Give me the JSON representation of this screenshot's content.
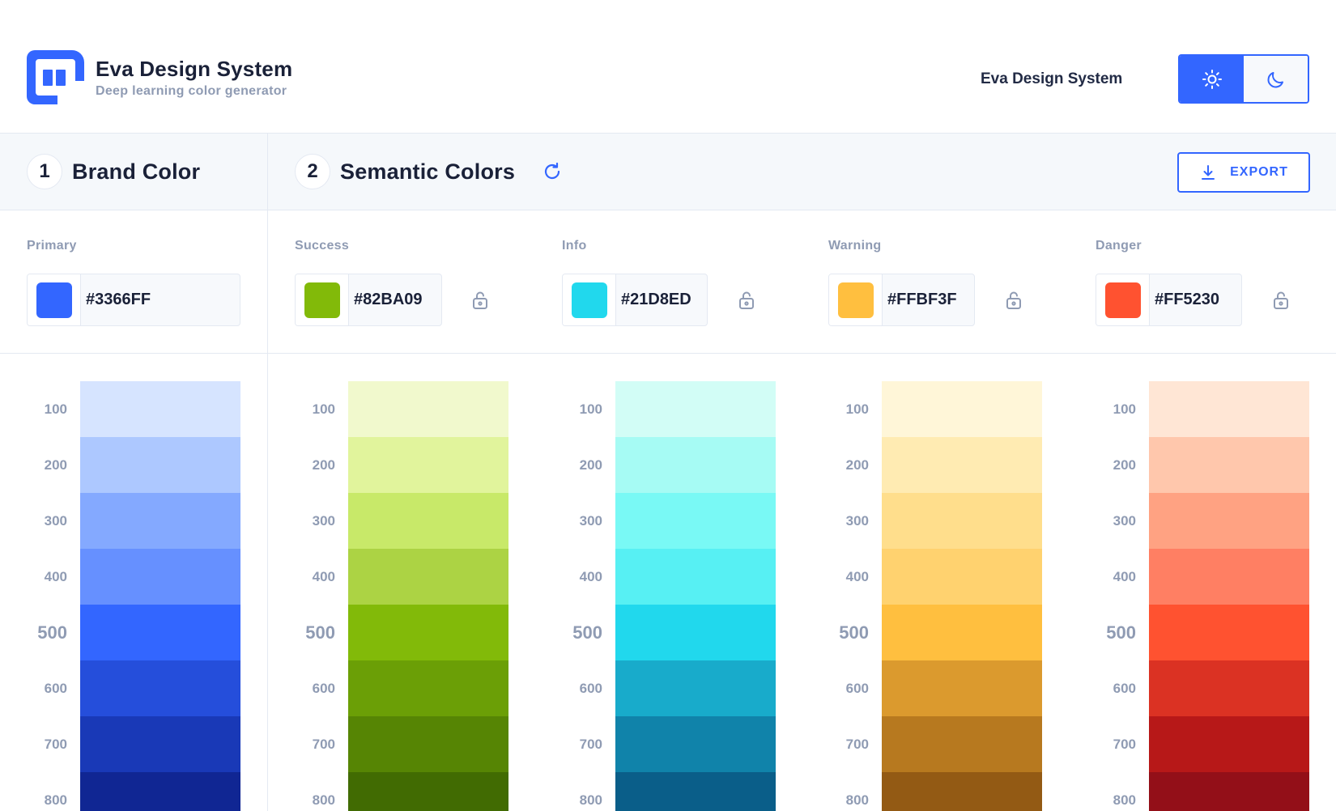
{
  "header": {
    "title": "Eva Design System",
    "subtitle": "Deep learning color generator",
    "link": "Eva Design System",
    "brand_color": "#3366ff"
  },
  "theme_toggle": {
    "options": [
      {
        "name": "light",
        "icon": "sun-icon",
        "active": true
      },
      {
        "name": "dark",
        "icon": "moon-icon",
        "active": false
      }
    ]
  },
  "sections": [
    {
      "number": "1",
      "title": "Brand Color"
    },
    {
      "number": "2",
      "title": "Semantic Colors",
      "icon": "refresh-icon"
    }
  ],
  "export_button": {
    "label": "EXPORT",
    "icon": "download-icon"
  },
  "columns": [
    {
      "label": "Primary",
      "hex": "#3366FF",
      "swatch": "#3366ff",
      "lockable": false,
      "shades": [
        "#d6e4ff",
        "#adc8ff",
        "#84a9ff",
        "#6690ff",
        "#3366ff",
        "#254edb",
        "#1939b7",
        "#102693"
      ]
    },
    {
      "label": "Success",
      "hex": "#82BA09",
      "swatch": "#82ba09",
      "lockable": true,
      "shades": [
        "#f1f9cd",
        "#e1f49c",
        "#c8e969",
        "#acd344",
        "#82ba09",
        "#6b9f06",
        "#568504",
        "#416b02"
      ]
    },
    {
      "label": "Info",
      "hex": "#21D8ED",
      "swatch": "#21d8ed",
      "lockable": true,
      "shades": [
        "#d2fdf6",
        "#a6fbf4",
        "#79f9f5",
        "#57f0f3",
        "#21d8ed",
        "#18abcb",
        "#1083aa",
        "#0a5e89"
      ]
    },
    {
      "label": "Warning",
      "hex": "#FFBF3F",
      "swatch": "#ffbf3f",
      "lockable": true,
      "shades": [
        "#fff6d8",
        "#ffebb2",
        "#ffde8c",
        "#ffd26f",
        "#ffbf3f",
        "#db9a2e",
        "#b7791f",
        "#935a14"
      ]
    },
    {
      "label": "Danger",
      "hex": "#FF5230",
      "swatch": "#ff5230",
      "lockable": true,
      "shades": [
        "#ffe6d5",
        "#ffc7ac",
        "#ffa282",
        "#ff7f63",
        "#ff5230",
        "#db3223",
        "#b71818",
        "#930f18"
      ]
    }
  ],
  "shade_labels": [
    "100",
    "200",
    "300",
    "400",
    "500",
    "600",
    "700",
    "800"
  ]
}
